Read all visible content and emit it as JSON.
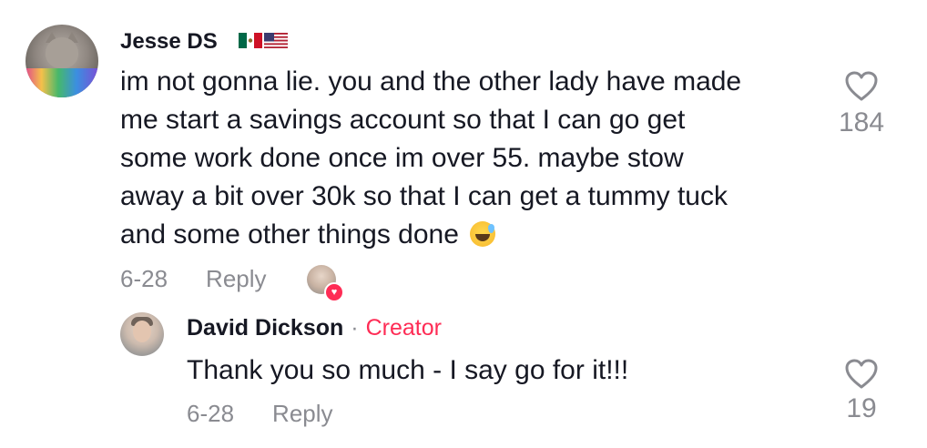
{
  "comment": {
    "username": "Jesse DS",
    "flags": [
      "mexico-flag-icon",
      "usa-flag-icon"
    ],
    "text_lines": [
      "im not gonna lie. you and the other lady have made",
      "me start a savings account so that I can go get",
      "some work done once im over 55. maybe stow",
      "away a bit over 30k so that I can get a tummy tuck",
      "and some other things done"
    ],
    "emoji": "grinning-sweat-emoji",
    "date": "6-28",
    "reply_label": "Reply",
    "like_count": "184",
    "creator_liked": true
  },
  "reply": {
    "username": "David Dickson",
    "separator": "·",
    "badge": "Creator",
    "text": "Thank you so much - I say go for it!!!",
    "date": "6-28",
    "reply_label": "Reply",
    "like_count": "19"
  },
  "colors": {
    "text": "#161823",
    "muted": "#8a8b91",
    "accent": "#fe2c55"
  }
}
